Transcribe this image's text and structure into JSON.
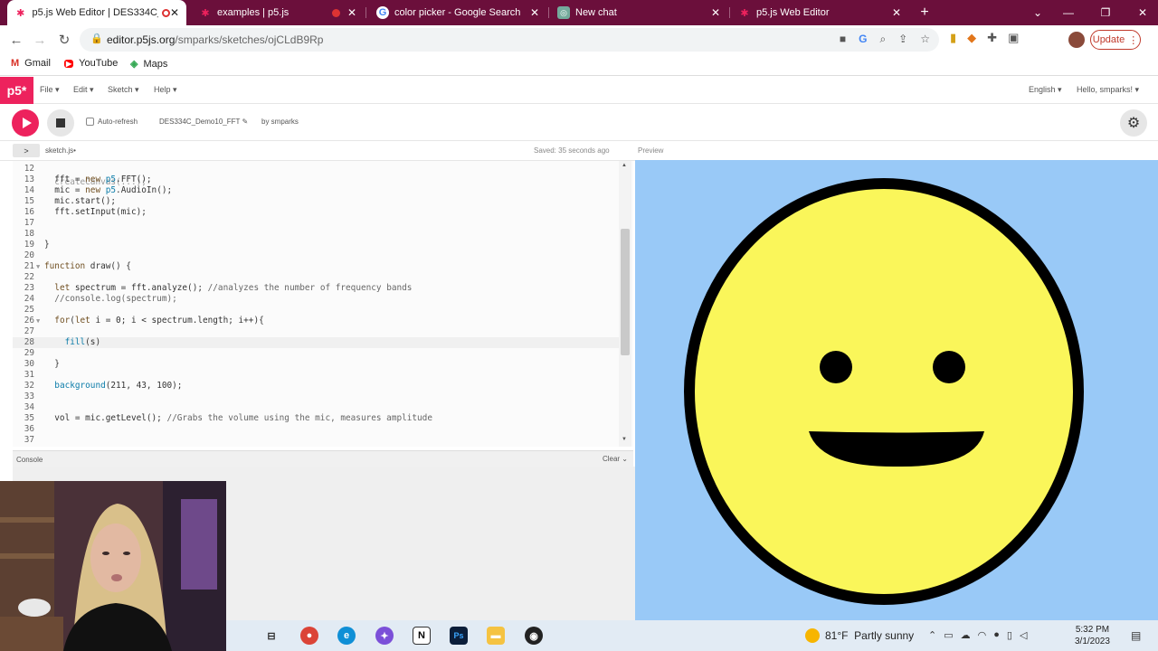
{
  "browser": {
    "tabs": [
      {
        "title": "p5.js Web Editor | DES334C_",
        "favicon": "p5-asterisk-icon",
        "active": true
      },
      {
        "title": "examples | p5.js",
        "favicon": "p5-asterisk-icon",
        "active": false
      },
      {
        "title": "color picker - Google Search",
        "favicon": "google-icon",
        "active": false
      },
      {
        "title": "New chat",
        "favicon": "chatgpt-icon",
        "active": false
      },
      {
        "title": "p5.js Web Editor",
        "favicon": "p5-asterisk-icon",
        "active": false
      }
    ],
    "url_host": "editor.p5js.org",
    "url_path": "/smparks/sketches/ojCLdB9Rp",
    "update_label": "Update",
    "bookmarks": [
      {
        "label": "Gmail",
        "icon": "gmail-icon"
      },
      {
        "label": "YouTube",
        "icon": "youtube-icon"
      },
      {
        "label": "Maps",
        "icon": "maps-icon"
      }
    ]
  },
  "p5": {
    "logo": "p5*",
    "menu": [
      "File",
      "Edit",
      "Sketch",
      "Help"
    ],
    "language": "English",
    "user": "Hello, smparks!",
    "auto_refresh": "Auto-refresh",
    "sketch_name": "DES334C_Demo10_FFT",
    "by_user": "by smparks",
    "file_name": "sketch.js",
    "saved_status": "Saved: 35 seconds ago",
    "preview_label": "Preview",
    "console_label": "Console",
    "clear_label": "Clear"
  },
  "code_lines": [
    {
      "n": "12",
      "text": ""
    },
    {
      "n": "13",
      "text": "  fft = new p5.FFT();"
    },
    {
      "n": "14",
      "text": "  mic = new p5.AudioIn();"
    },
    {
      "n": "15",
      "text": "  mic.start();"
    },
    {
      "n": "16",
      "text": "  fft.setInput(mic);"
    },
    {
      "n": "17",
      "text": ""
    },
    {
      "n": "18",
      "text": ""
    },
    {
      "n": "19",
      "text": "}"
    },
    {
      "n": "20",
      "text": ""
    },
    {
      "n": "21",
      "text": "function draw() {"
    },
    {
      "n": "22",
      "text": ""
    },
    {
      "n": "23",
      "text": "  let spectrum = fft.analyze(); //analyzes the number of frequency bands"
    },
    {
      "n": "24",
      "text": "  //console.log(spectrum);"
    },
    {
      "n": "25",
      "text": ""
    },
    {
      "n": "26",
      "text": "  for(let i = 0; i < spectrum.length; i++){"
    },
    {
      "n": "27",
      "text": ""
    },
    {
      "n": "28",
      "text": "    fill(s)"
    },
    {
      "n": "29",
      "text": ""
    },
    {
      "n": "30",
      "text": "  }"
    },
    {
      "n": "31",
      "text": ""
    },
    {
      "n": "32",
      "text": "  background(211, 43, 100);"
    },
    {
      "n": "33",
      "text": ""
    },
    {
      "n": "34",
      "text": ""
    },
    {
      "n": "35",
      "text": "  vol = mic.getLevel(); //Grabs the volume using the mic, measures amplitude"
    },
    {
      "n": "36",
      "text": ""
    },
    {
      "n": "37",
      "text": ""
    }
  ],
  "colors": {
    "p5_pink": "#ed225d",
    "preview_bg": "#99c9f7",
    "face_yellow": "#faf65a",
    "chrome_tabbar": "#6b0f3b"
  },
  "taskbar": {
    "temperature": "81°F",
    "weather": "Partly sunny",
    "time": "5:32 PM",
    "date": "3/1/2023",
    "apps": [
      "task-view-icon",
      "chrome-icon",
      "edge-icon",
      "messenger-icon",
      "notion-icon",
      "photoshop-icon",
      "file-explorer-icon",
      "obs-icon"
    ]
  }
}
